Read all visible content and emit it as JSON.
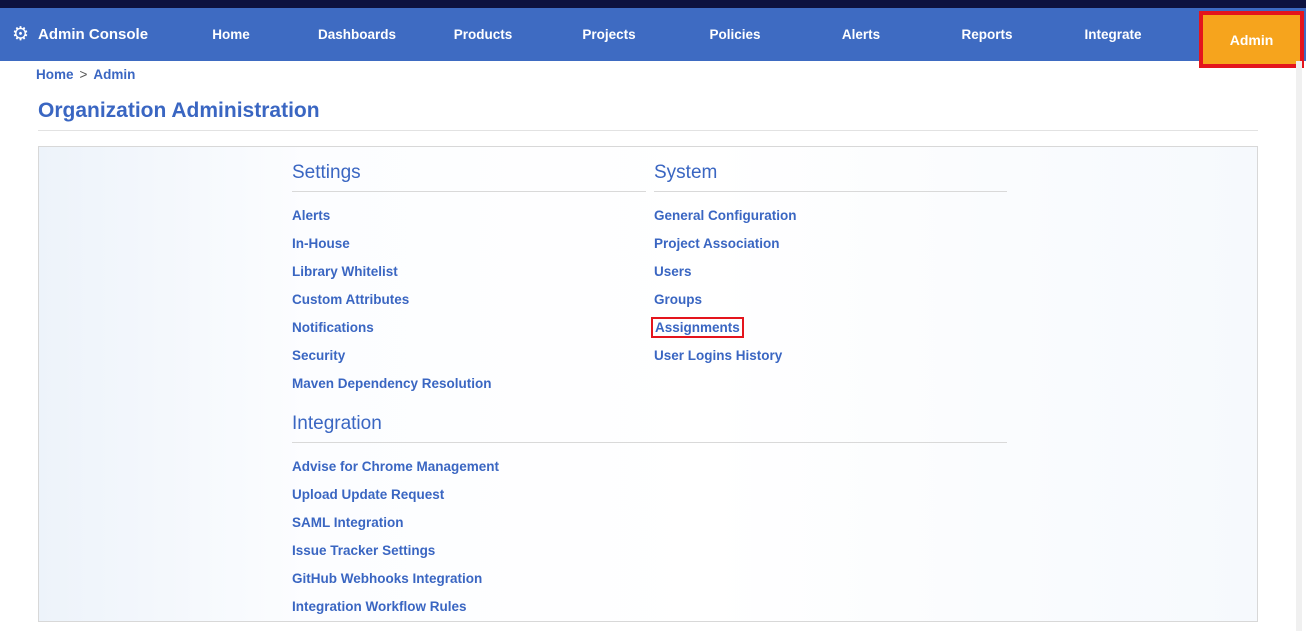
{
  "nav": {
    "brand_label": "Admin Console",
    "brand_icon": "gear-icon",
    "items": [
      "Home",
      "Dashboards",
      "Products",
      "Projects",
      "Policies",
      "Alerts",
      "Reports",
      "Integrate"
    ],
    "admin_button": "Admin"
  },
  "breadcrumb": {
    "home": "Home",
    "separator": ">",
    "current": "Admin"
  },
  "page": {
    "title": "Organization Administration"
  },
  "sections": [
    {
      "title": "Settings",
      "links": [
        "Alerts",
        "In-House",
        "Library Whitelist",
        "Custom Attributes",
        "Notifications",
        "Security",
        "Maven Dependency Resolution"
      ]
    },
    {
      "title": "System",
      "links": [
        "General Configuration",
        "Project Association",
        "Users",
        "Groups",
        "Assignments",
        "User Logins History"
      ],
      "highlighted_link": "Assignments"
    },
    {
      "title": "Integration",
      "span_columns": 2,
      "links": [
        "Advise for Chrome Management",
        "Upload Update Request",
        "SAML Integration",
        "Issue Tracker Settings",
        "GitHub Webhooks Integration",
        "Integration Workflow Rules"
      ]
    }
  ],
  "annotations": {
    "admin_button_boxed": true,
    "assignments_link_boxed": true,
    "box_color": "#e4151d"
  },
  "colors": {
    "topstrip": "#0d123f",
    "navbar": "#3e6bc2",
    "nav_text": "#ffffff",
    "admin_button_bg": "#f6a41d",
    "annotation_red": "#e4151d",
    "link_blue": "#3a66c2",
    "heading_blue": "#3a66c2",
    "panel_border": "#d8d8d8",
    "divider": "#d9d9d9",
    "breadcrumb_separator": "#555555",
    "scrollbar_track": "#f0f0f0"
  }
}
